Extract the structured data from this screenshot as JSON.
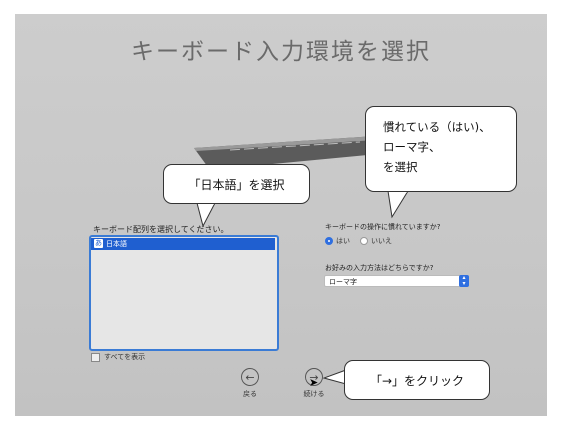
{
  "title": "キーボード入力環境を選択",
  "left_panel": {
    "label": "キーボード配列を選択してください。",
    "selected_item": "日本語",
    "selected_badge": "あ",
    "show_all_label": "すべてを表示"
  },
  "right_panel": {
    "question1": "キーボードの操作に慣れていますか?",
    "radio_yes": "はい",
    "radio_no": "いいえ",
    "radio_selected": "はい",
    "question2": "お好みの入力方法はどちらですか?",
    "input_method_value": "ローマ字"
  },
  "navigation": {
    "back_label": "戻る",
    "continue_label": "続ける"
  },
  "annotations": {
    "japanese_callout": "「日本語」を選択",
    "ime_callout_line1": "慣れている（はい)、",
    "ime_callout_line2": "ローマ字、",
    "ime_callout_line3": "を選択",
    "continue_callout": "「→」をクリック"
  },
  "colors": {
    "accent": "#1f5fd0",
    "background": "#c9c9c9"
  }
}
